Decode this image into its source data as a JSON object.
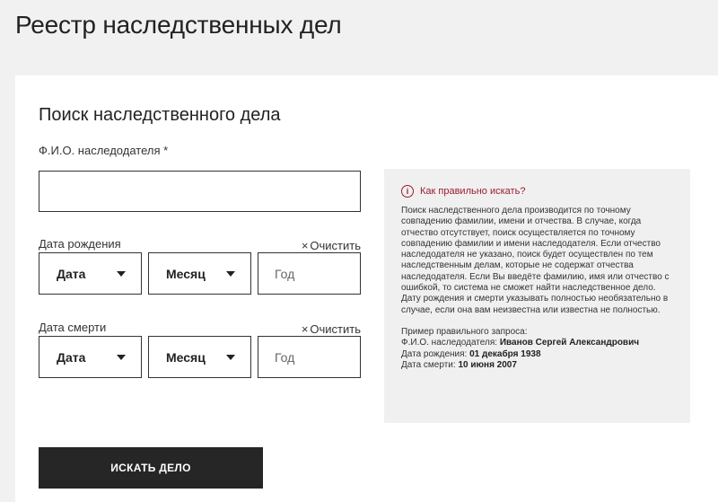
{
  "page_title": "Реестр наследственных дел",
  "form": {
    "title": "Поиск наследственного дела",
    "fio_label": "Ф.И.О. наследодателя *",
    "fio_value": "",
    "birth_label": "Дата рождения",
    "death_label": "Дата смерти",
    "clear_label": "Очистить",
    "day_label": "Дата",
    "month_label": "Месяц",
    "year_placeholder": "Год",
    "submit_label": "ИСКАТЬ ДЕЛО"
  },
  "help": {
    "title": "Как правильно искать?",
    "text": "Поиск наследственного дела производится по точному совпадению фамилии, имени и отчества. В случае, когда отчество отсутствует, поиск осуществляется по точному совпадению фамилии и имени наследодателя. Если отчество наследодателя не указано, поиск будет осуществлен по тем наследственным делам, которые не содержат отчества наследодателя. Если Вы введёте фамилию, имя или отчество с ошибкой, то система не сможет найти наследственное дело. Дату рождения и смерти указывать полностью необязательно в случае, если она вам неизвестна или известна не полностью.",
    "example_intro": "Пример правильного запроса:",
    "example_fio_label": "Ф.И.О. наследодателя: ",
    "example_fio": "Иванов Сергей Александрович",
    "example_birth_label": "Дата рождения: ",
    "example_birth": "01 декабря 1938",
    "example_death_label": "Дата смерти: ",
    "example_death": "10 июня 2007"
  },
  "colors": {
    "accent": "#9b1b30",
    "button_bg": "#262626",
    "page_bg": "#f1f1f1"
  }
}
